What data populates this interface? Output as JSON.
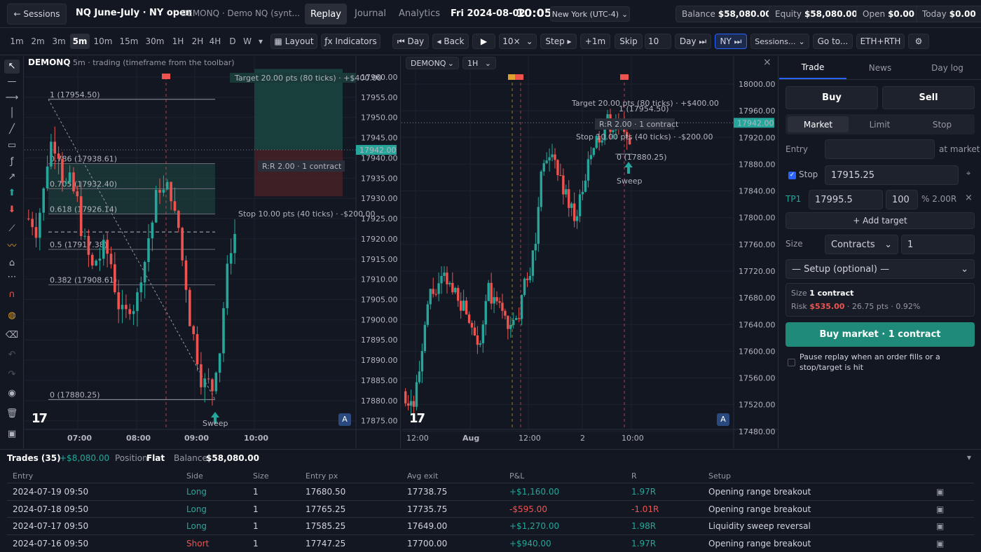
{
  "topbar": {
    "back_label": "← Sessions",
    "session_title": "NQ June-July · NY open",
    "session_subtitle": "DEMONQ · Demo NQ (synt...",
    "tabs": [
      "Replay",
      "Journal",
      "Analytics"
    ],
    "date": "Fri 2024-08-02",
    "time": "10:05",
    "timezone": "New York (UTC-4)",
    "stats": [
      {
        "label": "Balance",
        "value": "$58,080.00"
      },
      {
        "label": "Equity",
        "value": "$58,080.00"
      },
      {
        "label": "Open",
        "value": "$0.00"
      },
      {
        "label": "Today",
        "value": "$0.00"
      }
    ]
  },
  "toolbar": {
    "timeframes": [
      "1m",
      "2m",
      "3m",
      "5m",
      "10m",
      "15m",
      "30m",
      "1H",
      "2H",
      "4H",
      "D",
      "W"
    ],
    "active_timeframe": "5m",
    "tf_more": "▾",
    "layout_label": "Layout",
    "indicators_label": "ƒx Indicators",
    "day_back_label": "⏮ Day",
    "back_label": "◂ Back",
    "play_label": "▶",
    "speed": "10×",
    "step_label": "Step ▸",
    "plus1m_label": "+1m",
    "skip_label": "Skip",
    "skip_value": "10",
    "day_fwd_label": "Day ⏭",
    "ny_label": "NY ⏭",
    "sessions_label": "Sessions...",
    "goto_label": "Go to...",
    "ethrth_label": "ETH+RTH",
    "settings_icon": "gear-icon"
  },
  "left_chart": {
    "symbol": "DEMONQ",
    "info": "· 5m · trading (timeframe from the toolbar)",
    "price_labels": [
      "17960.00",
      "17955.00",
      "17950.00",
      "17945.00",
      "17940.00",
      "17935.00",
      "17930.00",
      "17925.00",
      "17920.00",
      "17915.00",
      "17910.00",
      "17905.00",
      "17900.00",
      "17895.00",
      "17890.00",
      "17885.00",
      "17880.00",
      "17875.00"
    ],
    "current_price": "17942.00",
    "time_labels": [
      "07:00",
      "08:00",
      "09:00",
      "10:00"
    ],
    "fib_labels": [
      "1 (17954.50)",
      "0.786 (17938.61)",
      "0.705 (17932.40)",
      "0.618 (17926.14)",
      "0.5 (17917.38)",
      "0.382 (17908.61)",
      "0 (17880.25)"
    ],
    "target_label": "Target 20.00 pts (80 ticks) · +$400.00",
    "stop_label": "Stop 10.00 pts (40 ticks) · -$200.00",
    "rr_label": "R:R 2.00 · 1 contract",
    "sweep_label": "Sweep",
    "auto_label": "A",
    "logo": "17"
  },
  "right_chart": {
    "symbol": "DEMONQ",
    "timeframe": "1H",
    "price_labels": [
      "18000.00",
      "17960.00",
      "17920.00",
      "17880.00",
      "17840.00",
      "17800.00",
      "17760.00",
      "17720.00",
      "17680.00",
      "17640.00",
      "17600.00",
      "17560.00",
      "17520.00",
      "17480.00"
    ],
    "current_price": "17942.00",
    "time_labels": [
      "12:00",
      "Aug",
      "12:00",
      "2",
      "10:00"
    ],
    "target_label": "Target 20.00 pts (80 ticks) · +$400.00",
    "stop_label": "Stop 10.00 pts (40 ticks) · -$200.00",
    "rr_label": "R:R 2.00 · 1 contract",
    "fib_zero": "0 (17880.25)",
    "fib_one": "1 (17954.50)",
    "sweep_label": "Sweep",
    "auto_label": "A",
    "logo": "17",
    "close_icon": "×"
  },
  "panel": {
    "tabs": [
      "Trade",
      "News",
      "Day log"
    ],
    "buy_label": "Buy",
    "sell_label": "Sell",
    "order_types": [
      "Market",
      "Limit",
      "Stop"
    ],
    "entry_label": "Entry",
    "entry_suffix": "at market",
    "stop_label": "Stop",
    "stop_value": "17915.25",
    "tp_label": "TP1",
    "tp_value": "17995.5",
    "tp_pct": "100",
    "tp_rr": "% 2.00R",
    "add_target": "+ Add target",
    "size_label": "Size",
    "size_unit": "Contracts",
    "size_value": "1",
    "setup_placeholder": "— Setup (optional) —",
    "summary_size_label": "Size",
    "summary_size_value": "1 contract",
    "summary_risk_label": "Risk",
    "summary_risk_value": "$535.00",
    "summary_risk_detail": "· 26.75 pts · 0.92%",
    "submit_label": "Buy market · 1 contract",
    "pause_label": "Pause replay when an order fills or a stop/target is hit"
  },
  "trades": {
    "title": "Trades (35)",
    "total_pnl": "+$8,080.00",
    "position_label": "Position",
    "position_value": "Flat",
    "balance_label": "Balance",
    "balance_value": "$58,080.00",
    "collapse_icon": "▾",
    "columns": [
      "Entry",
      "Side",
      "Size",
      "Entry px",
      "Avg exit",
      "P&L",
      "R",
      "Setup"
    ],
    "rows": [
      {
        "entry": "2024-07-19 09:50",
        "side": "Long",
        "size": "1",
        "entry_px": "17680.50",
        "avg_exit": "17738.75",
        "pnl": "+$1,160.00",
        "r": "1.97R",
        "setup": "Opening range breakout"
      },
      {
        "entry": "2024-07-18 09:50",
        "side": "Long",
        "size": "1",
        "entry_px": "17765.25",
        "avg_exit": "17735.75",
        "pnl": "-$595.00",
        "r": "-1.01R",
        "setup": "Opening range breakout"
      },
      {
        "entry": "2024-07-17 09:50",
        "side": "Long",
        "size": "1",
        "entry_px": "17585.25",
        "avg_exit": "17649.00",
        "pnl": "+$1,270.00",
        "r": "1.98R",
        "setup": "Liquidity sweep reversal"
      },
      {
        "entry": "2024-07-16 09:50",
        "side": "Short",
        "size": "1",
        "entry_px": "17747.25",
        "avg_exit": "17700.00",
        "pnl": "+$940.00",
        "r": "1.97R",
        "setup": "Opening range breakout"
      }
    ]
  },
  "colors": {
    "up": "#26a69a",
    "down": "#ef5350",
    "accent": "#2962ff",
    "bg": "#131722"
  }
}
